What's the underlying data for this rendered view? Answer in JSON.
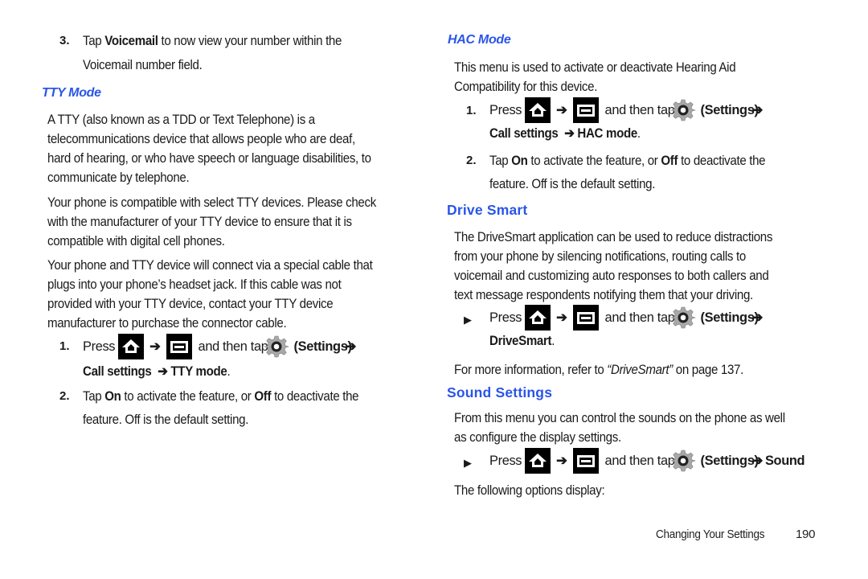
{
  "left": {
    "step3": {
      "number": "3.",
      "line1_pre": "Tap ",
      "line1_bold": "Voicemail",
      "line1_post": " to now view your number within the",
      "line2": "Voicemail number field."
    },
    "tty_heading": "TTY Mode",
    "tty_para1": [
      "A TTY (also known as a TDD or Text Telephone) is a",
      "telecommunications device that allows people who are deaf,",
      "hard of hearing, or who have speech or language disabilities, to",
      "communicate by telephone."
    ],
    "tty_para2": [
      "Your phone is compatible with select TTY devices. Please check",
      "with the manufacturer of your TTY device to ensure that it is",
      "compatible with digital cell phones."
    ],
    "tty_para3": [
      "Your phone and TTY device will connect via a special cable that",
      "plugs into your phone’s headset jack. If this cable was not",
      "provided with your TTY device, contact your TTY device",
      "manufacturer to purchase the connector cable."
    ],
    "step1": {
      "number": "1.",
      "press": "Press",
      "arrow": "➔",
      "and_then_tap": "and then tap",
      "settings": "(Settings)",
      "line2_a": "Call settings",
      "line2_b": "TTY mode",
      "period": "."
    },
    "step2": {
      "number": "2.",
      "pre": "Tap ",
      "on": "On",
      "mid": " to activate the feature, or ",
      "off": "Off",
      "post": " to deactivate the",
      "line2": "feature. Off is the default setting."
    }
  },
  "right": {
    "hac_heading": "HAC Mode",
    "hac_para": [
      "This menu is used to activate or deactivate Hearing Aid",
      "Compatibility for this device."
    ],
    "hac_step1": {
      "number": "1.",
      "press": "Press",
      "arrow": "➔",
      "and_then_tap": "and then tap",
      "settings": "(Settings)",
      "line2_a": "Call settings",
      "line2_b": "HAC mode",
      "period": "."
    },
    "hac_step2": {
      "number": "2.",
      "pre": "Tap ",
      "on": "On",
      "mid": " to activate the feature, or ",
      "off": "Off",
      "post": " to deactivate the",
      "line2": "feature. Off is the default setting."
    },
    "drive_heading": "Drive Smart",
    "drive_para": [
      "The DriveSmart application can be used to reduce distractions",
      "from your phone by silencing notifications, routing calls to",
      "voicemail and customizing auto responses to both callers and",
      "text message respondents notifying them that your driving."
    ],
    "drive_step": {
      "bullet": "▶",
      "press": "Press",
      "arrow": "➔",
      "and_then_tap": "and then tap",
      "settings": "(Settings)",
      "line2": "DriveSmart",
      "period": "."
    },
    "drive_ref": {
      "pre": "For more information, refer to ",
      "link": "“DriveSmart”",
      "post": " on page 137."
    },
    "sound_heading": "Sound Settings",
    "sound_para": [
      "From this menu you can control the sounds on the phone as well",
      "as configure the display settings."
    ],
    "sound_step": {
      "bullet": "▶",
      "press": "Press",
      "arrow": "➔",
      "and_then_tap": "and then tap",
      "settings": "(Settings)",
      "target": "Sound",
      "period": "."
    },
    "sound_following": "The following options display:"
  },
  "footer": {
    "section": "Changing Your Settings",
    "page": "190"
  },
  "colors": {
    "heading": "#2a55e8",
    "text": "#1a1a1a",
    "icon_bg": "#000000",
    "gear": "#a8a8a8"
  },
  "icons": {
    "home": "home-icon",
    "menu": "menu-icon",
    "settings": "gear-icon"
  }
}
